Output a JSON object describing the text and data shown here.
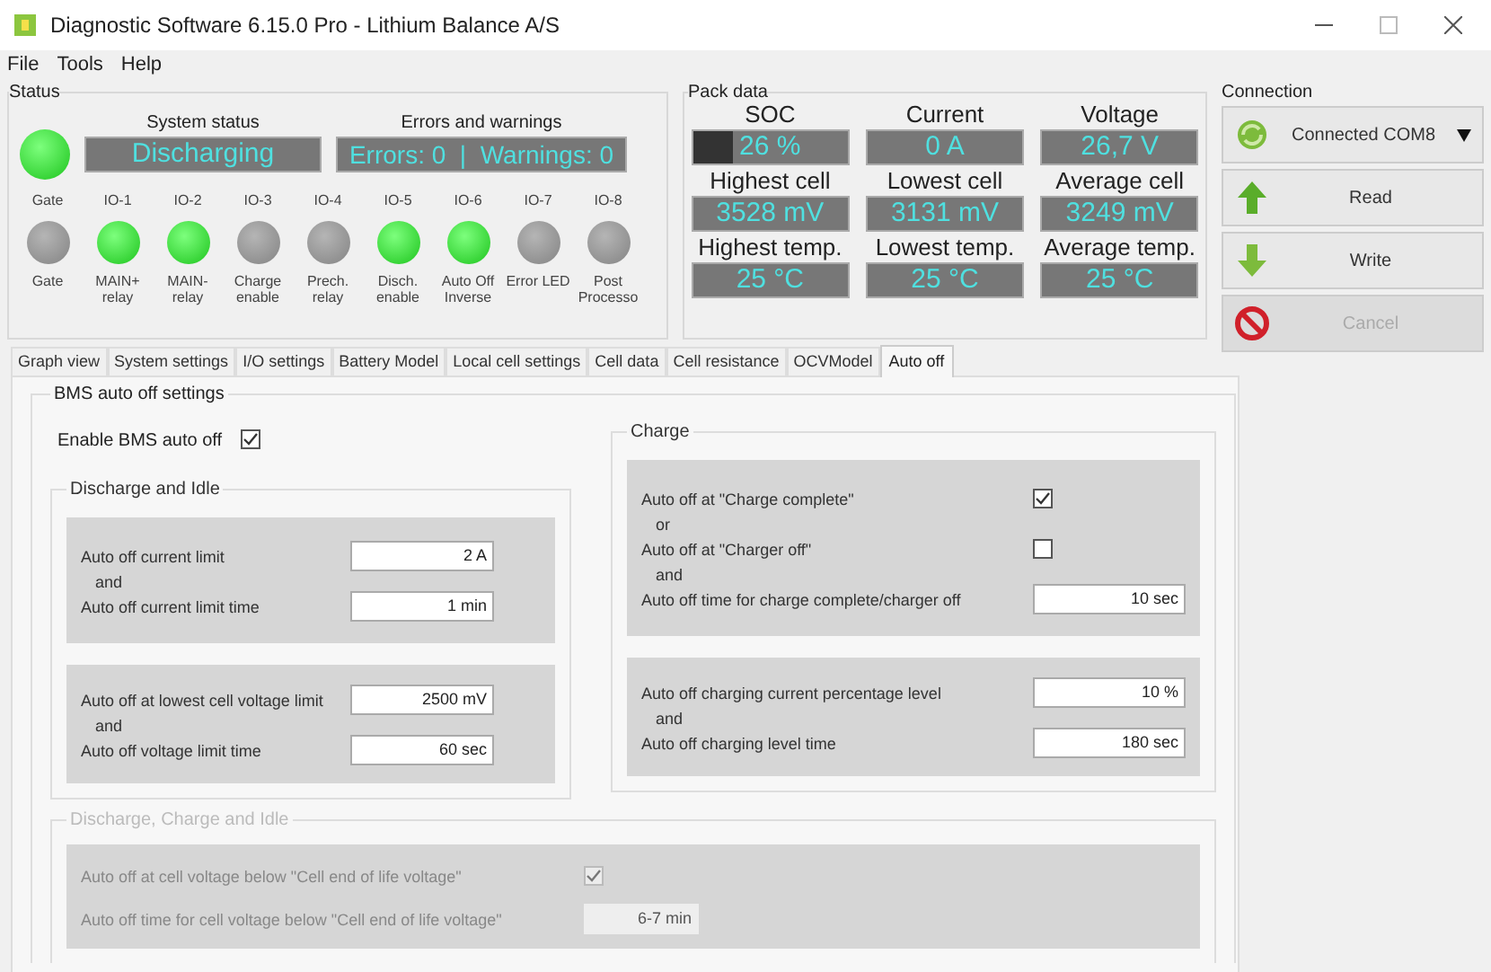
{
  "window": {
    "title": "Diagnostic Software 6.15.0 Pro - Lithium Balance A/S"
  },
  "menu": [
    "File",
    "Tools",
    "Help"
  ],
  "status": {
    "title": "Status",
    "main_led_on": true,
    "system_status": {
      "label": "System status",
      "value": "Discharging"
    },
    "errors": {
      "label": "Errors and warnings",
      "value": "Errors: 0  |  Warnings: 0"
    },
    "ios": [
      {
        "top": "Gate",
        "on": false,
        "bottom": "Gate"
      },
      {
        "top": "IO-1",
        "on": true,
        "bottom": "MAIN+ relay"
      },
      {
        "top": "IO-2",
        "on": true,
        "bottom": "MAIN- relay"
      },
      {
        "top": "IO-3",
        "on": false,
        "bottom": "Charge enable"
      },
      {
        "top": "IO-4",
        "on": false,
        "bottom": "Prech. relay"
      },
      {
        "top": "IO-5",
        "on": true,
        "bottom": "Disch. enable"
      },
      {
        "top": "IO-6",
        "on": true,
        "bottom": "Auto Off Inverse"
      },
      {
        "top": "IO-7",
        "on": false,
        "bottom": "Error LED"
      },
      {
        "top": "IO-8",
        "on": false,
        "bottom": "Post Processo"
      }
    ]
  },
  "pack_data": {
    "title": "Pack data",
    "cells": [
      {
        "label": "SOC",
        "value": "26 %",
        "level": 0.26
      },
      {
        "label": "Current",
        "value": "0 A"
      },
      {
        "label": "Voltage",
        "value": "26,7 V"
      },
      {
        "label": "Highest cell",
        "value": "3528 mV"
      },
      {
        "label": "Lowest cell",
        "value": "3131 mV"
      },
      {
        "label": "Average cell",
        "value": "3249 mV"
      },
      {
        "label": "Highest temp.",
        "value": "25 °C"
      },
      {
        "label": "Lowest temp.",
        "value": "25 °C"
      },
      {
        "label": "Average temp.",
        "value": "25 °C"
      }
    ]
  },
  "connection": {
    "title": "Connection",
    "buttons": [
      {
        "kind": "connect",
        "label": "Connected COM8",
        "disabled": false
      },
      {
        "kind": "read",
        "label": "Read",
        "disabled": false
      },
      {
        "kind": "write",
        "label": "Write",
        "disabled": false
      },
      {
        "kind": "cancel",
        "label": "Cancel",
        "disabled": true
      }
    ]
  },
  "tabs": [
    {
      "label": "Graph view",
      "selected": false
    },
    {
      "label": "System settings",
      "selected": false
    },
    {
      "label": "I/O settings",
      "selected": false
    },
    {
      "label": "Battery Model",
      "selected": false
    },
    {
      "label": "Local cell settings",
      "selected": false
    },
    {
      "label": "Cell data",
      "selected": false
    },
    {
      "label": "Cell resistance",
      "selected": false
    },
    {
      "label": "OCVModel",
      "selected": false
    },
    {
      "label": "Auto off",
      "selected": true
    }
  ],
  "auto_off": {
    "title": "BMS auto off settings",
    "enable_label": "Enable BMS auto off",
    "enable_checked": true,
    "groups": [
      {
        "title": "Discharge and Idle",
        "disabled": false,
        "panels": [
          [
            {
              "kind": "field",
              "label": "Auto off current limit",
              "value": "2 A"
            },
            {
              "kind": "connector",
              "label": "and"
            },
            {
              "kind": "field",
              "label": "Auto off current limit time",
              "value": "1 min"
            }
          ],
          [
            {
              "kind": "field",
              "label": "Auto off at lowest cell voltage limit",
              "value": "2500 mV"
            },
            {
              "kind": "connector",
              "label": "and"
            },
            {
              "kind": "field",
              "label": "Auto off voltage limit time",
              "value": "60 sec"
            }
          ]
        ]
      },
      {
        "title": "Charge",
        "disabled": false,
        "panels": [
          [
            {
              "kind": "checkbox",
              "label": "Auto off at \"Charge complete\"",
              "checked": true
            },
            {
              "kind": "connector",
              "label": "or"
            },
            {
              "kind": "checkbox",
              "label": "Auto off at \"Charger off\"",
              "checked": false
            },
            {
              "kind": "connector",
              "label": "and"
            },
            {
              "kind": "field",
              "label": "Auto off time for charge complete/charger off",
              "value": "10 sec"
            }
          ],
          [
            {
              "kind": "field",
              "label": "Auto off charging current percentage level",
              "value": "10 %"
            },
            {
              "kind": "connector",
              "label": "and"
            },
            {
              "kind": "field",
              "label": "Auto off charging level time",
              "value": "180 sec"
            }
          ]
        ]
      },
      {
        "title": "Discharge, Charge and Idle",
        "disabled": true,
        "panels": [
          [
            {
              "kind": "checkbox",
              "label": "Auto off at cell voltage below \"Cell end of life voltage\"",
              "checked": true
            },
            {
              "kind": "field",
              "label": "Auto off time for cell voltage below \"Cell end of life voltage\"",
              "value": "6-7 min"
            }
          ]
        ]
      }
    ]
  }
}
